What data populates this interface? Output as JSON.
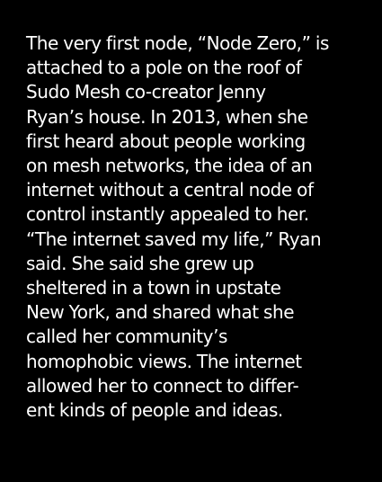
{
  "article": {
    "lines": [
      "The very first node, “Node Zero,” is",
      "attached to a pole on the roof of",
      "Sudo Mesh co-creator Jenny",
      "Ryan’s house. In 2013, when she",
      "first heard about people working",
      "on mesh networks, the idea of an",
      "internet without a central node of",
      "control instantly appealed to her.",
      "“The internet saved my life,” Ryan",
      "said. She said she grew up",
      "sheltered in a town in upstate",
      "New York, and shared what she",
      "called her community’s",
      "homophobic views. The internet",
      "allowed her to connect to differ-",
      "ent kinds of people and ideas."
    ]
  },
  "colors": {
    "background": "#000000",
    "text": "#ffffff"
  }
}
